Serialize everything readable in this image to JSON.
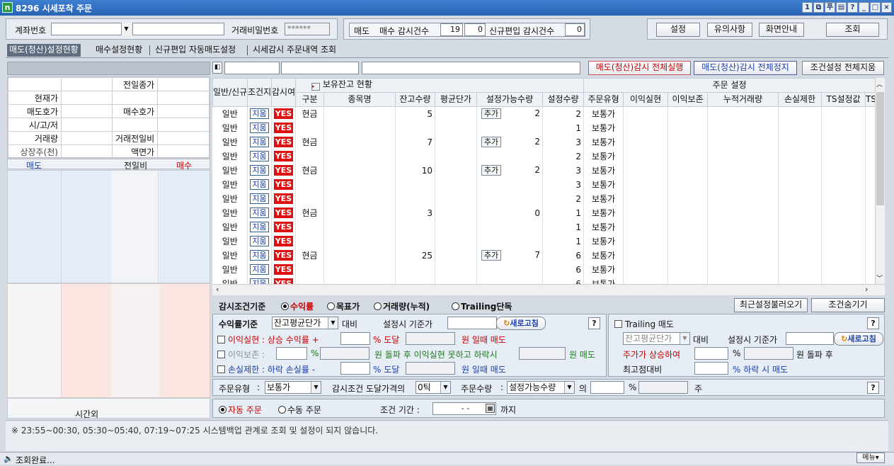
{
  "window": {
    "title": "8296 시세포착 주문",
    "buttons": [
      "1",
      "5",
      "푸",
      "▤",
      "?",
      "_",
      "□",
      "×"
    ]
  },
  "account": {
    "label": "계좌번호",
    "password_label": "거래비밀번호",
    "password_value": "******"
  },
  "monitor": {
    "sell_label": "매도",
    "buy_watch_label": "매수 감시건수",
    "buy_watch_count": "19",
    "buy_watch_extra": "0",
    "new_watch_label": "신규편입 감시건수",
    "new_watch_count": "0"
  },
  "top_buttons": {
    "settings": "설정",
    "notes": "유의사항",
    "screen_guide": "화면안내",
    "query": "조회"
  },
  "tabs": [
    "매도(청산)설정현황",
    "매수설정현황",
    "신규편입 자동매도설정",
    "시세감시 주문내역 조회"
  ],
  "action_buttons": {
    "run_all": "매도(청산)감시 전체실행",
    "stop_all": "매도(청산)감시 전체정지",
    "delete_all": "조건설정 전체지움"
  },
  "quote": {
    "prev_close": "전일종가",
    "current": "현재가",
    "ask": "매도호가",
    "bid": "매수호가",
    "ohl": "시/고/저",
    "volume": "거래량",
    "volume_ratio": "거래전일비",
    "listed": "상장주(천)",
    "par": "액면가"
  },
  "orderbook": {
    "sell": "매도",
    "change": "전일비",
    "buy": "매수",
    "after_hours": "시간외"
  },
  "grid": {
    "group_holdings": "보유잔고 현황",
    "group_order": "주문 설정",
    "headers": [
      "일반/신규편입",
      "조건지움",
      "감시여부",
      "구분",
      "종목명",
      "잔고수량",
      "평균단가",
      "설정가능수량",
      "설정수량",
      "주문유형",
      "이익실현",
      "이익보존",
      "누적거래량",
      "손실제한",
      "TS설정값",
      "TS"
    ],
    "delete_label": "지움",
    "add_label": "추가",
    "rows": [
      {
        "type": "일반",
        "watch": "YES",
        "kind": "현금",
        "qty": "5",
        "add": true,
        "avail": "2",
        "set": "2",
        "order": "보통가"
      },
      {
        "type": "일반",
        "watch": "YES",
        "kind": "",
        "qty": "",
        "add": false,
        "avail": "",
        "set": "1",
        "order": "보통가"
      },
      {
        "type": "일반",
        "watch": "YES",
        "kind": "현금",
        "qty": "7",
        "add": true,
        "avail": "2",
        "set": "3",
        "order": "보통가"
      },
      {
        "type": "일반",
        "watch": "YES",
        "kind": "",
        "qty": "",
        "add": false,
        "avail": "",
        "set": "2",
        "order": "보통가"
      },
      {
        "type": "일반",
        "watch": "YES",
        "kind": "현금",
        "qty": "10",
        "add": true,
        "avail": "2",
        "set": "3",
        "order": "보통가"
      },
      {
        "type": "일반",
        "watch": "YES",
        "kind": "",
        "qty": "",
        "add": false,
        "avail": "",
        "set": "3",
        "order": "보통가"
      },
      {
        "type": "일반",
        "watch": "YES",
        "kind": "",
        "qty": "",
        "add": false,
        "avail": "",
        "set": "2",
        "order": "보통가"
      },
      {
        "type": "일반",
        "watch": "YES",
        "kind": "현금",
        "qty": "3",
        "add": false,
        "avail": "0",
        "set": "1",
        "order": "보통가"
      },
      {
        "type": "일반",
        "watch": "YES",
        "kind": "",
        "qty": "",
        "add": false,
        "avail": "",
        "set": "1",
        "order": "보통가"
      },
      {
        "type": "일반",
        "watch": "YES",
        "kind": "",
        "qty": "",
        "add": false,
        "avail": "",
        "set": "1",
        "order": "보통가"
      },
      {
        "type": "일반",
        "watch": "YES",
        "kind": "현금",
        "qty": "25",
        "add": true,
        "avail": "7",
        "set": "6",
        "order": "보통가"
      },
      {
        "type": "일반",
        "watch": "YES",
        "kind": "",
        "qty": "",
        "add": false,
        "avail": "",
        "set": "6",
        "order": "보통가"
      },
      {
        "type": "일반",
        "watch": "YES",
        "kind": "",
        "qty": "",
        "add": false,
        "avail": "",
        "set": "6",
        "order": "보통가"
      }
    ]
  },
  "criteria": {
    "label": "감시조건기준",
    "options": [
      "수익률",
      "목표가",
      "거래량(누적)",
      "Trailing단독"
    ],
    "selected": 0,
    "load_recent": "최근설정불러오기",
    "hide": "조건숨기기"
  },
  "profit": {
    "label": "수익률기준",
    "basis": "잔고평균단가",
    "vs": "대비",
    "ref_label": "설정시 기준가",
    "refresh": "새로고침",
    "take_profit": {
      "label": "이익실현",
      "text1": ": 상승 수익률 +",
      "pct": "% 도달",
      "text2": "원 일때 매도"
    },
    "preserve": {
      "label": "이익보존",
      "text1": ":",
      "pct": "%",
      "text2": "원 돌파 후 이익실현 못하고 하락시",
      "text3": "원 매도"
    },
    "stop_loss": {
      "label": "손실제한",
      "text1": ": 하락 손실률 -",
      "pct": "% 도달",
      "text2": "원 일때 매도"
    }
  },
  "trailing": {
    "label": "Trailing 매도",
    "basis": "잔고평균단가",
    "vs": "대비",
    "ref_label": "설정시 기준가",
    "refresh": "새로고침",
    "rise_text": "주가가 상승하여",
    "pct": "%",
    "breakout": "원 돌파 후",
    "peak_label": "최고점대비",
    "fall_text": "% 하락 시 매도"
  },
  "order": {
    "type_label": "주문유형",
    "type_value": "보통가",
    "reach_label": "감시조건 도달가격의",
    "tick_value": "0틱",
    "qty_label": "주문수량",
    "qty_value": "설정가능수량",
    "of": "의",
    "pct": "%",
    "shares": "주"
  },
  "mode": {
    "auto": "자동 주문",
    "manual": "수동 주문",
    "period_label": "조건 기간 :",
    "date_value": "-  -",
    "until": "까지"
  },
  "notice": "※ 23:55~00:30, 05:30~05:40, 07:19~07:25 시스템백업 관계로 조회 및 설정이 되지 않습니다.",
  "status": {
    "text": "조회완료...",
    "menu": "메뉴"
  }
}
